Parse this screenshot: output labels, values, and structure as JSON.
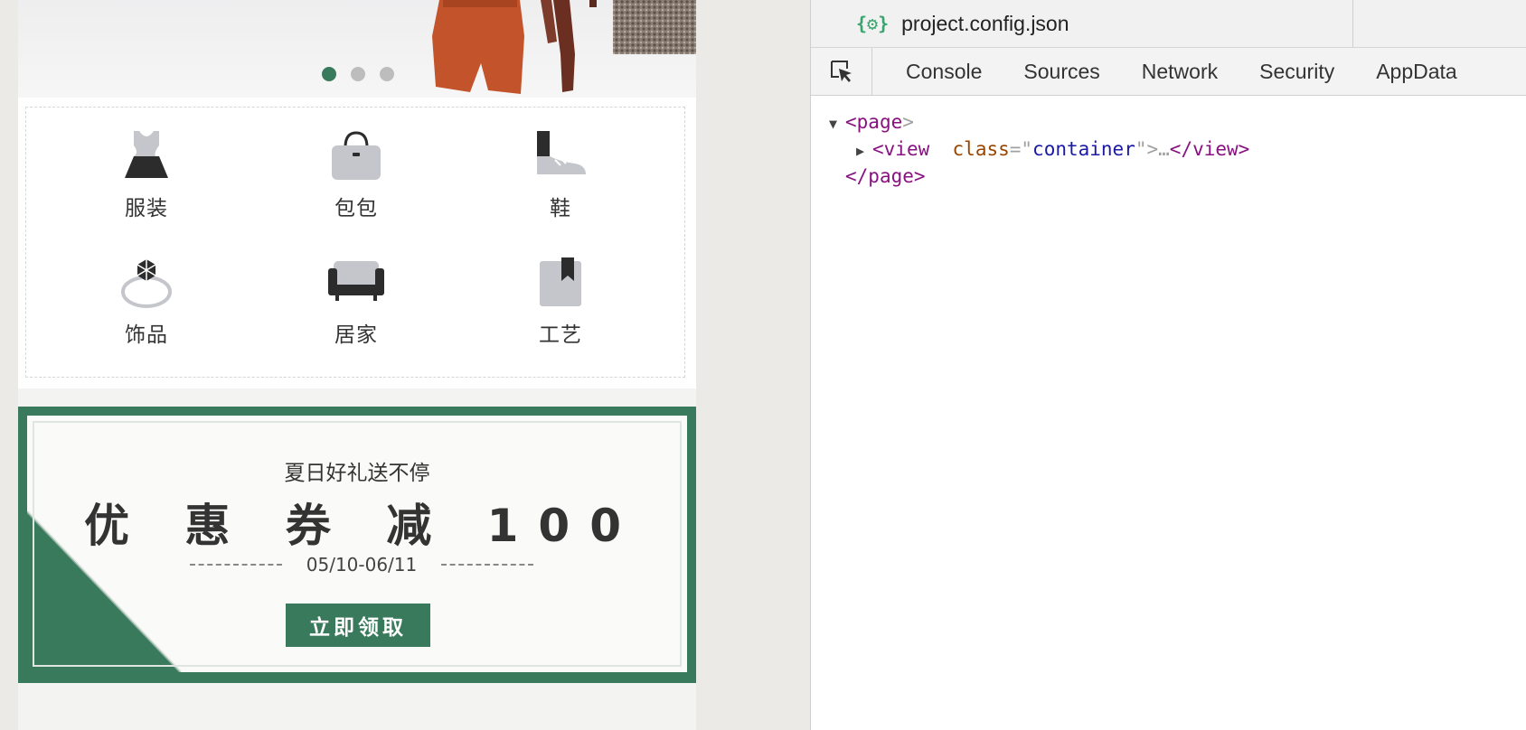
{
  "simulator": {
    "banner": {
      "slide_count": 3,
      "active_slide": 0
    },
    "categories": [
      {
        "label": "服装",
        "icon": "dress-icon"
      },
      {
        "label": "包包",
        "icon": "handbag-icon"
      },
      {
        "label": "鞋",
        "icon": "shoe-icon"
      },
      {
        "label": "饰品",
        "icon": "ring-icon"
      },
      {
        "label": "居家",
        "icon": "sofa-icon"
      },
      {
        "label": "工艺",
        "icon": "bookmark-box-icon"
      }
    ],
    "coupon": {
      "subtitle": "夏日好礼送不停",
      "title": "优 惠 券 减 100",
      "date_range": "05/10-06/11",
      "button_label": "立即领取"
    }
  },
  "devtools": {
    "file_tab": {
      "icon": "{⚙}",
      "name": "project.config.json"
    },
    "tabs": [
      "Console",
      "Sources",
      "Network",
      "Security",
      "AppData"
    ],
    "dom_tree": {
      "page_tag": "page",
      "view_tag": "view",
      "view_attr_name": "class",
      "view_attr_value": "container",
      "collapsed_marker": "…"
    }
  },
  "colors": {
    "accent_green": "#3a7a5c",
    "dom_tag": "#881280",
    "dom_attr": "#994500",
    "dom_value": "#1a1aa6"
  }
}
